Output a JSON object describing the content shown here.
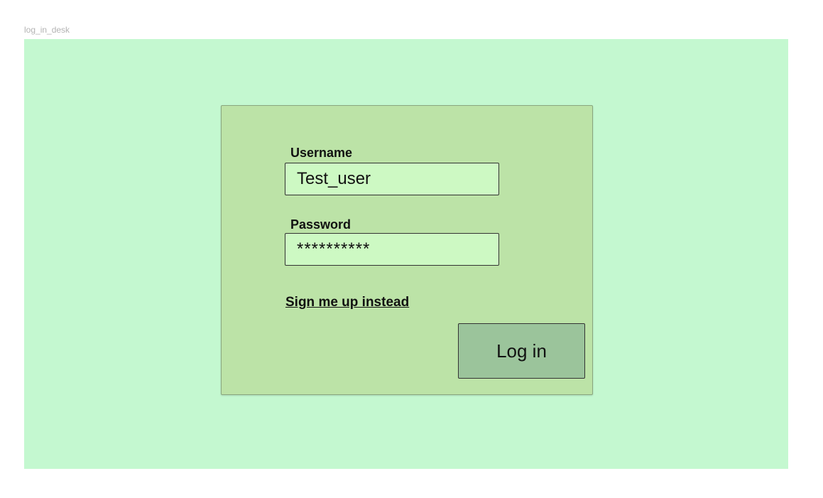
{
  "frame": {
    "label": "log_in_desk"
  },
  "login_form": {
    "username_label": "Username",
    "username_value": "Test_user",
    "password_label": "Password",
    "password_value": "**********",
    "signup_link": "Sign me  up instead",
    "login_button": "Log in"
  },
  "colors": {
    "frame_background": "#c4f8d0",
    "card_background": "#bce3a7",
    "input_background": "#cdf9c3",
    "button_background": "#9bc49b"
  }
}
